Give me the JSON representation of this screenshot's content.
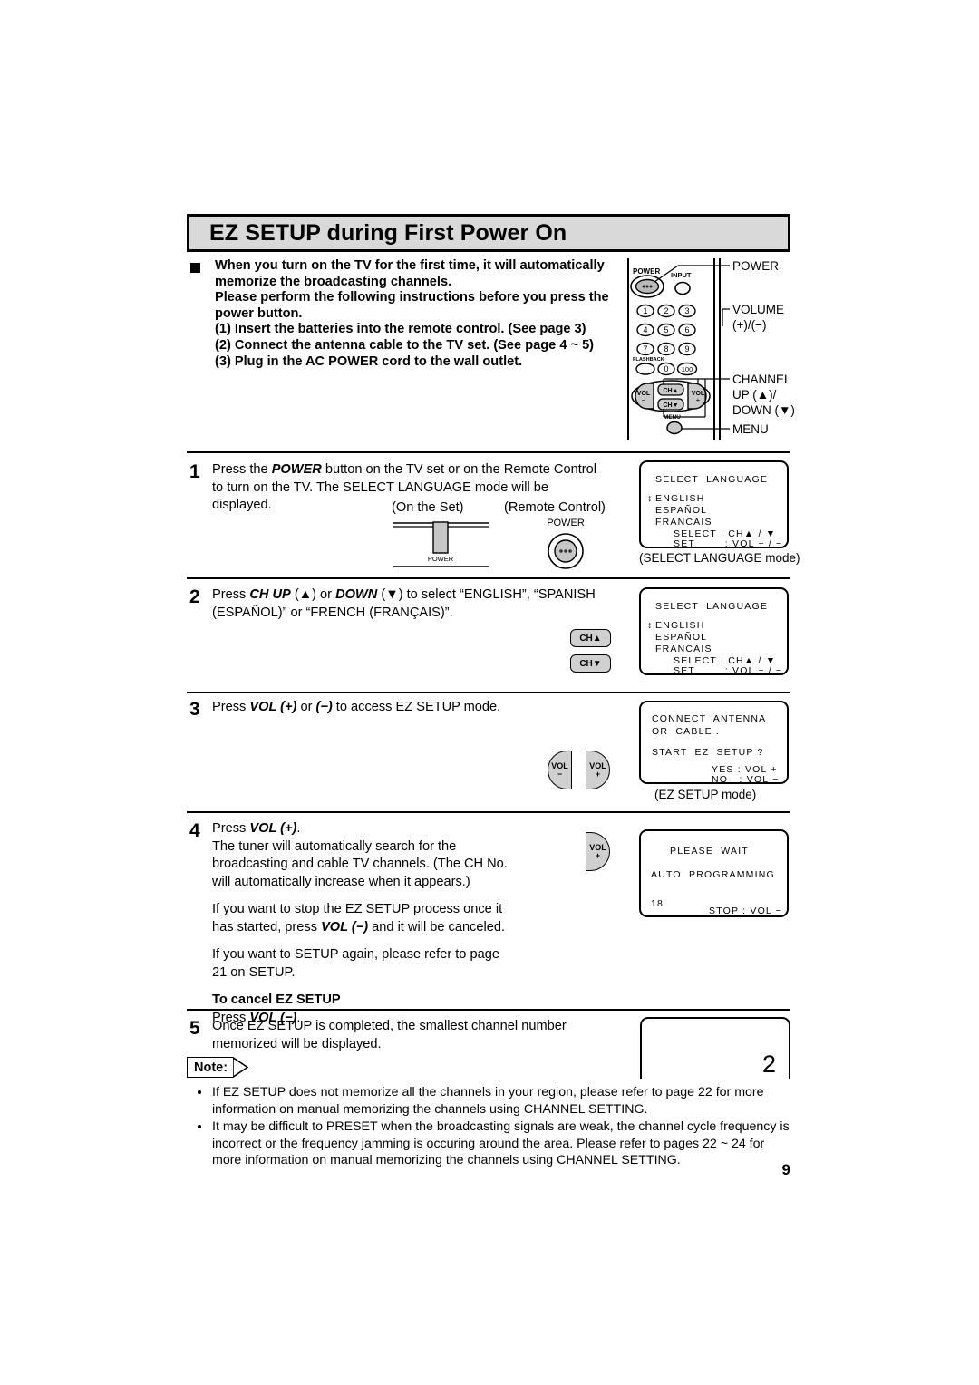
{
  "header": {
    "title": "EZ SETUP during First Power On"
  },
  "intro": {
    "lines": [
      "When you turn on the TV for the first time, it will automatically",
      "memorize the broadcasting channels.",
      "Please perform the following instructions before you press the",
      "power button."
    ],
    "sub_items": [
      "(1) Insert the batteries into the remote control. (See page 3)",
      "(2) Connect the antenna cable to the TV set.  (See page 4 ~ 5)",
      "(3) Plug in the AC POWER cord to the wall outlet."
    ]
  },
  "remote_diagram": {
    "button_labels": {
      "power": "POWER",
      "input": "INPUT",
      "flashback": "FLASHBACK",
      "menu": "MENU",
      "vol_minus": "VOL",
      "vol_plus": "VOL",
      "ch_up": "CH",
      "ch_down": "CH",
      "num_1": "1",
      "num_2": "2",
      "num_3": "3",
      "num_4": "4",
      "num_5": "5",
      "num_6": "6",
      "num_7": "7",
      "num_8": "8",
      "num_9": "9",
      "num_0": "0",
      "num_100": "100"
    },
    "callouts": [
      "POWER",
      "VOLUME",
      "(+)/(−)",
      "CHANNEL",
      "UP (▲)/",
      "DOWN (▼)",
      "MENU"
    ]
  },
  "steps": [
    {
      "number": "1",
      "lines": [
        "Press the POWER button on the TV set or on the Remote Control",
        "to turn on the TV. The SELECT LANGUAGE mode will be",
        "displayed."
      ],
      "diagram_labels": {
        "on_the_set": "(On the Set)",
        "remote_control": "(Remote Control)",
        "set_power": "POWER",
        "rc_power": "POWER"
      }
    },
    {
      "number": "2",
      "lines": [
        "Press CH UP (▲) or DOWN (▼) to select “ENGLISH”, “SPANISH",
        "(ESPAÑOL)” or “FRENCH (FRANÇAIS)”."
      ],
      "buttons": [
        "CH▲",
        "CH▼"
      ]
    },
    {
      "number": "3",
      "lines": [
        "Press VOL (+) or (−) to access EZ SETUP mode."
      ],
      "buttons": [
        "VOL−",
        "VOL+"
      ]
    },
    {
      "number": "4",
      "lines": [
        "Press VOL (+).",
        "The tuner will automatically search for the",
        "broadcasting and cable TV channels. (The CH No.",
        "will automatically increase when it appears.)",
        "If you want to stop the EZ SETUP process once it",
        "has started, press VOL (−) and it will be canceled.",
        "If you want to SETUP again, please refer to page",
        "21 on SETUP."
      ],
      "cancel_heading": "To cancel EZ SETUP",
      "cancel_text": "Press VOL (−).",
      "buttons": [
        "VOL+"
      ]
    },
    {
      "number": "5",
      "lines": [
        "Once EZ SETUP is completed, the smallest channel number",
        "memorized will be displayed."
      ],
      "channel_number": "2"
    }
  ],
  "osd_screens": {
    "select_language_1": {
      "title": "SELECT  LANGUAGE",
      "cursor": "↕",
      "options": [
        "ENGLISH",
        "ESPAÑOL",
        "FRANCAIS"
      ],
      "select_row": "SELECT : CH▲ / ▼",
      "set_row": "SET        : VOL + / −",
      "caption": "(SELECT LANGUAGE mode)"
    },
    "select_language_2": {
      "title": "SELECT  LANGUAGE",
      "cursor": "↕",
      "options": [
        "ENGLISH",
        "ESPAÑOL",
        "FRANCAIS"
      ],
      "select_row": "SELECT : CH▲ / ▼",
      "set_row": "SET        : VOL + / −"
    },
    "ez_setup": {
      "line1": "CONNECT  ANTENNA",
      "line2": "OR  CABLE .",
      "line3": "START  EZ  SETUP ?",
      "yes_row": "YES : VOL +",
      "no_row": "NO   : VOL −",
      "caption": "(EZ SETUP mode)"
    },
    "please_wait": {
      "line1": "PLEASE  WAIT",
      "line2": "AUTO  PROGRAMMING",
      "counter": "18",
      "stop_row": "STOP : VOL −"
    }
  },
  "note": {
    "label": "Note:",
    "items": [
      "If EZ SETUP does not memorize all the channels in your region, please refer to page 22 for more information on manual memorizing the channels using CHANNEL SETTING.",
      "It may be difficult to PRESET when the broadcasting signals are weak, the channel cycle frequency is incorrect or the frequency jamming is occuring around the area. Please refer to pages 22 ~ 24 for more information on manual memorizing the channels using CHANNEL SETTING."
    ]
  },
  "footer": {
    "page_number": "9"
  }
}
